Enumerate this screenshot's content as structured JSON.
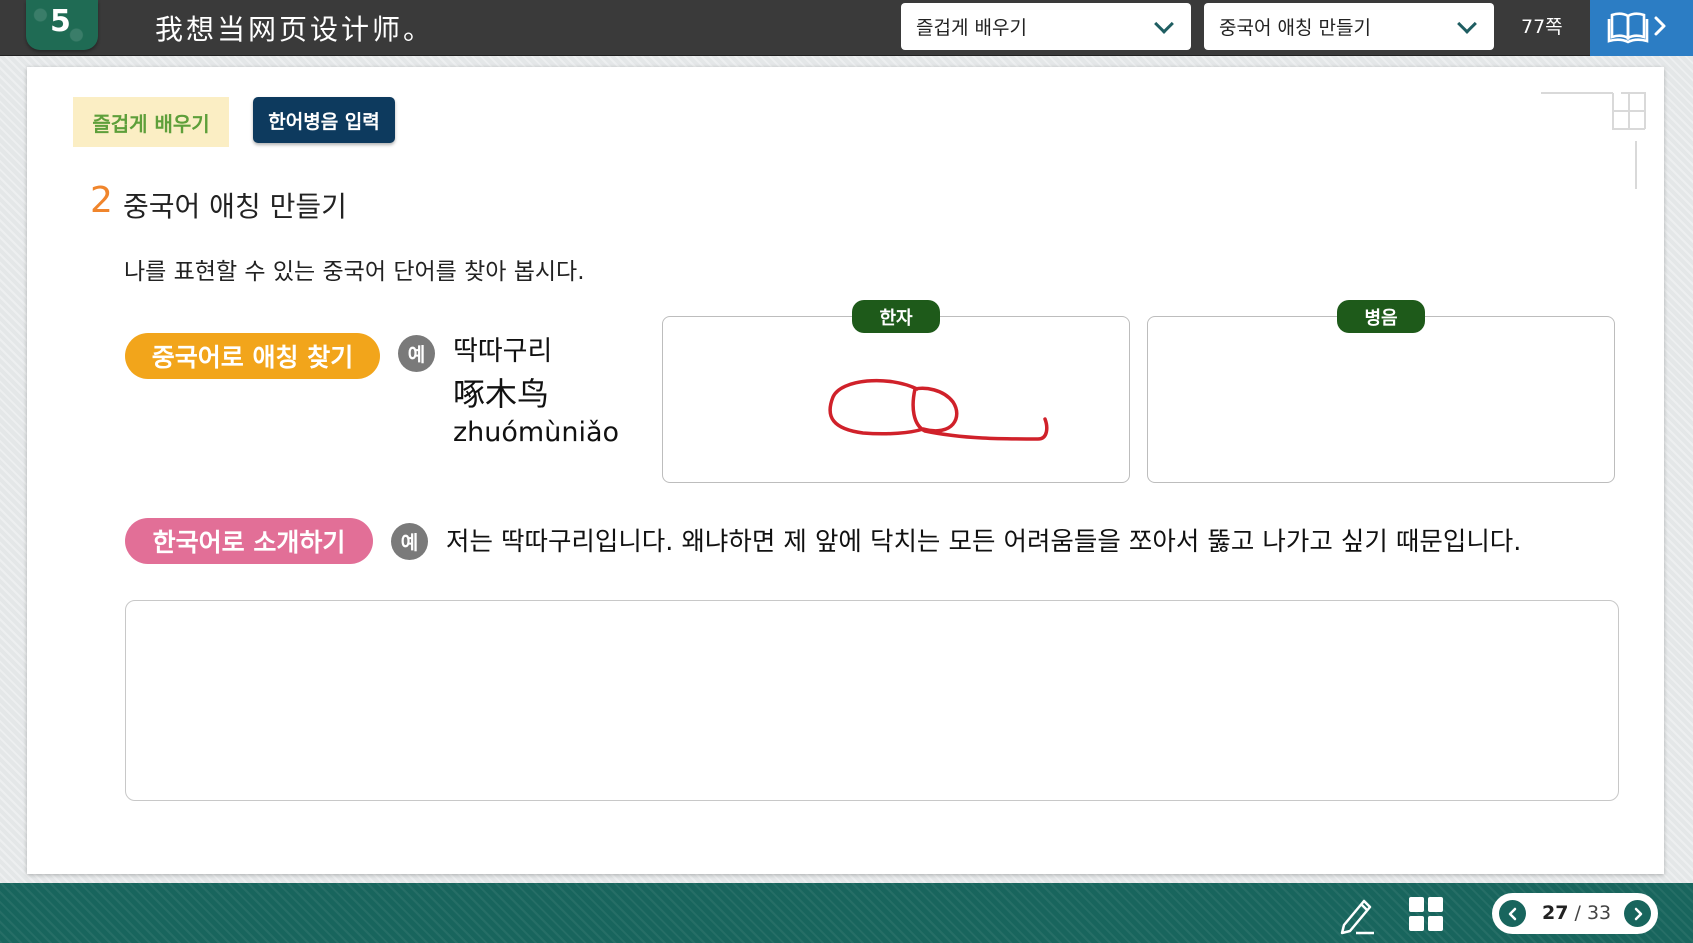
{
  "header": {
    "lesson_number": "5",
    "lesson_title": "我想当网页设计师。",
    "select_section": "즐겁게 배우기",
    "select_activity": "중국어 애칭 만들기",
    "page_ref": "77쪽"
  },
  "content": {
    "section_tag": "즐겁게 배우기",
    "pinyin_button": "한어병음 입력",
    "section_number": "2",
    "section_title": "중국어 애칭 만들기",
    "instruction": "나를 표현할 수 있는 중국어 단어를 찾아 봅시다.",
    "find_label": "중국어로 애칭 찾기",
    "example_mark": "예",
    "example_word": "딱따구리",
    "example_hanzi": "啄木鸟",
    "example_pinyin": "zhuómùniǎo",
    "hanzi_box_label": "한자",
    "pinyin_box_label": "병음",
    "intro_label": "한국어로 소개하기",
    "intro_sentence": "저는 딱따구리입니다. 왜냐하면 제 앞에 닥치는 모든 어려움들을 쪼아서 뚫고 나가고 싶기 때문입니다."
  },
  "footer": {
    "current_page": "27",
    "separator": "/",
    "total_pages": "33"
  },
  "colors": {
    "accent_orange": "#f2a51b",
    "accent_pink": "#e26f97",
    "label_green": "#1e5a1a",
    "footer_teal": "#18655d",
    "ink_red": "#d0212a"
  },
  "icons": [
    "chevron-down-icon",
    "book-icon",
    "chevron-right-icon",
    "pen-icon",
    "grid-icon",
    "chevron-left-icon"
  ]
}
